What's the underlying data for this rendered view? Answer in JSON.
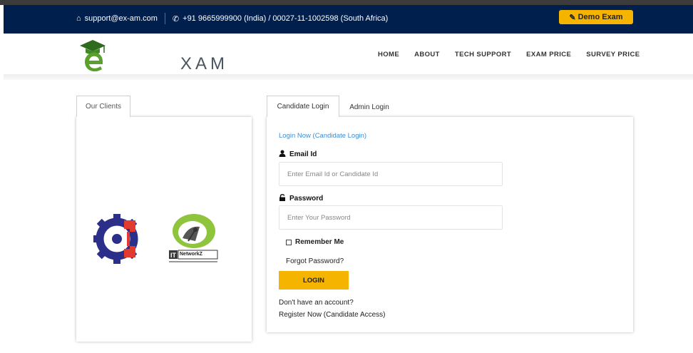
{
  "topbar": {
    "email": "support@ex-am.com",
    "phone": "+91 9665999900 (India) / 00027-11-1002598 (South Africa)",
    "demo_label": "Demo Exam",
    "email_icon": "home-icon",
    "phone_icon": "phone-icon",
    "demo_icon": "edit-icon"
  },
  "logo": {
    "text": "XAM"
  },
  "nav": [
    "HOME",
    "ABOUT",
    "TECH SUPPORT",
    "EXAM PRICE",
    "SURVEY PRICE"
  ],
  "clients": {
    "tab_label": "Our Clients",
    "logo2_text": "NetworkZ"
  },
  "login": {
    "tabs": [
      "Candidate Login",
      "Admin Login"
    ],
    "heading": "Login Now (Candidate Login)",
    "email_label": "Email Id",
    "email_placeholder": "Enter Email Id or Candidate Id",
    "password_label": "Password",
    "password_placeholder": "Enter Your Password",
    "remember_label": "Remember Me",
    "forgot_label": "Forgot Password?",
    "login_button": "LOGIN",
    "no_account": "Don't have an account?",
    "register_link": "Register Now (Candidate Access)",
    "user_icon": "user-icon",
    "lock_icon": "lock-icon"
  },
  "colors": {
    "topbar_bg": "#001f4d",
    "accent": "#f5b400",
    "link": "#3b8dd6",
    "logo_green": "#5aa02c"
  }
}
